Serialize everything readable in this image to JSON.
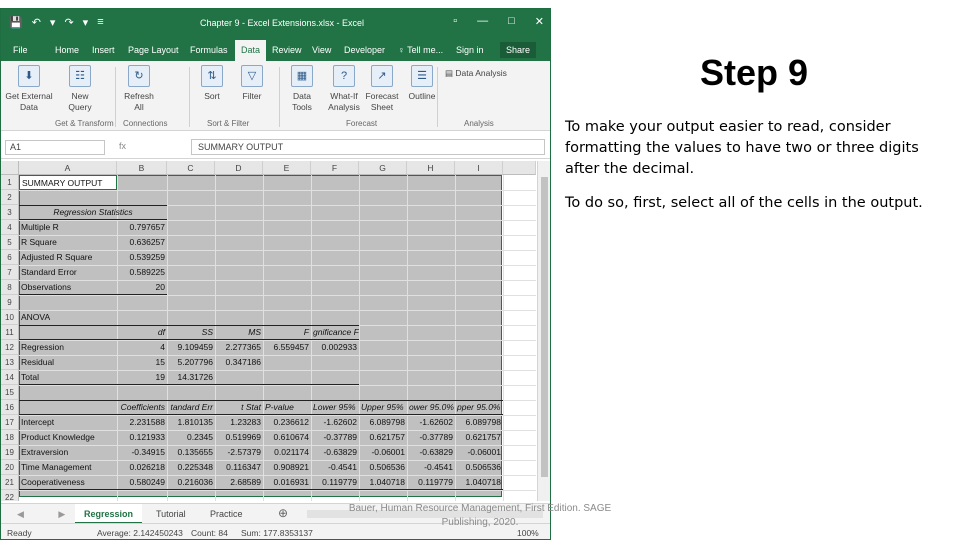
{
  "window": {
    "title": "Chapter 9 - Excel Extensions.xlsx - Excel",
    "qat": [
      "💾",
      "↶",
      "▾",
      "↷",
      "▾",
      "≡"
    ],
    "controls": [
      "▫",
      "—",
      "□",
      "✕"
    ]
  },
  "tabs": [
    "File",
    "Home",
    "Insert",
    "Page Layout",
    "Formulas",
    "Data",
    "Review",
    "View",
    "Developer",
    "♀ Tell me...",
    "Sign in",
    "Share"
  ],
  "ribbon": {
    "buttons": [
      {
        "label": "Get External\nData",
        "icon": "⬇"
      },
      {
        "label": "New\nQuery",
        "icon": "☷"
      },
      {
        "label": "Refresh\nAll",
        "icon": "↻"
      },
      {
        "label": "Sort",
        "icon": "⇅"
      },
      {
        "label": "Filter",
        "icon": "▽"
      },
      {
        "label": "Data\nTools",
        "icon": "▦"
      },
      {
        "label": "What-If\nAnalysis",
        "icon": "?"
      },
      {
        "label": "Forecast\nSheet",
        "icon": "↗"
      },
      {
        "label": "Outline",
        "icon": "☰"
      }
    ],
    "groups": [
      "Get & Transform",
      "Connections",
      "Sort & Filter",
      "Forecast",
      "Analysis"
    ],
    "data_analysis": "Data Analysis"
  },
  "formula_bar": {
    "name_box": "A1",
    "fx": "fx",
    "content": "SUMMARY OUTPUT"
  },
  "columns": [
    "A",
    "B",
    "C",
    "D",
    "E",
    "F",
    "G",
    "H",
    "I"
  ],
  "rows": [
    "1",
    "2",
    "3",
    "4",
    "5",
    "6",
    "7",
    "8",
    "9",
    "10",
    "11",
    "12",
    "13",
    "14",
    "15",
    "16",
    "17",
    "18",
    "19",
    "20",
    "21",
    "22"
  ],
  "sheet": {
    "summary": "SUMMARY OUTPUT",
    "reg_stats_title": "Regression Statistics",
    "reg_stats": [
      [
        "Multiple R",
        "0.797657"
      ],
      [
        "R Square",
        "0.636257"
      ],
      [
        "Adjusted R Square",
        "0.539259"
      ],
      [
        "Standard Error",
        "0.589225"
      ],
      [
        "Observations",
        "20"
      ]
    ],
    "anova_title": "ANOVA",
    "anova_header": [
      "df",
      "SS",
      "MS",
      "F",
      "gnificance F"
    ],
    "anova": [
      [
        "Regression",
        "4",
        "9.109459",
        "2.277365",
        "6.559457",
        "0.002933"
      ],
      [
        "Residual",
        "15",
        "5.207796",
        "0.347186",
        "",
        ""
      ],
      [
        "Total",
        "19",
        "14.31726",
        "",
        "",
        ""
      ]
    ],
    "coef_header": [
      "Coefficients",
      "tandard Err",
      "t Stat",
      "P-value",
      "Lower 95%",
      "Upper 95%",
      "ower 95.0%",
      "pper 95.0%"
    ],
    "coef": [
      [
        "Intercept",
        "2.231588",
        "1.810135",
        "1.23283",
        "0.236612",
        "-1.62602",
        "6.089798",
        "-1.62602",
        "6.089798"
      ],
      [
        "Product Knowledge",
        "0.121933",
        "0.2345",
        "0.519969",
        "0.610674",
        "-0.37789",
        "0.621757",
        "-0.37789",
        "0.621757"
      ],
      [
        "Extraversion",
        "-0.34915",
        "0.135655",
        "-2.57379",
        "0.021174",
        "-0.63829",
        "-0.06001",
        "-0.63829",
        "-0.06001"
      ],
      [
        "Time Management",
        "0.026218",
        "0.225348",
        "0.116347",
        "0.908921",
        "-0.4541",
        "0.506536",
        "-0.4541",
        "0.506536"
      ],
      [
        "Cooperativeness",
        "0.580249",
        "0.216036",
        "2.68589",
        "0.016931",
        "0.119779",
        "1.040718",
        "0.119779",
        "1.040718"
      ]
    ]
  },
  "sheet_tabs": [
    "Regression",
    "Tutorial",
    "Practice"
  ],
  "sheet_add": "⊕",
  "sheet_nav": "◀ ▶",
  "status": {
    "ready": "Ready",
    "average": "Average: 2.142450243",
    "count": "Count: 84",
    "sum": "Sum: 177.8353137",
    "zoom": "100%"
  },
  "slide": {
    "title": "Step 9",
    "para1": "To make your output easier to read, consider formatting the values to have two or three digits after the decimal.",
    "para2": "To do so, first, select all of the cells in the output.",
    "source": "Bauer, Human Resource Management, First Edition. SAGE Publishing, 2020."
  }
}
